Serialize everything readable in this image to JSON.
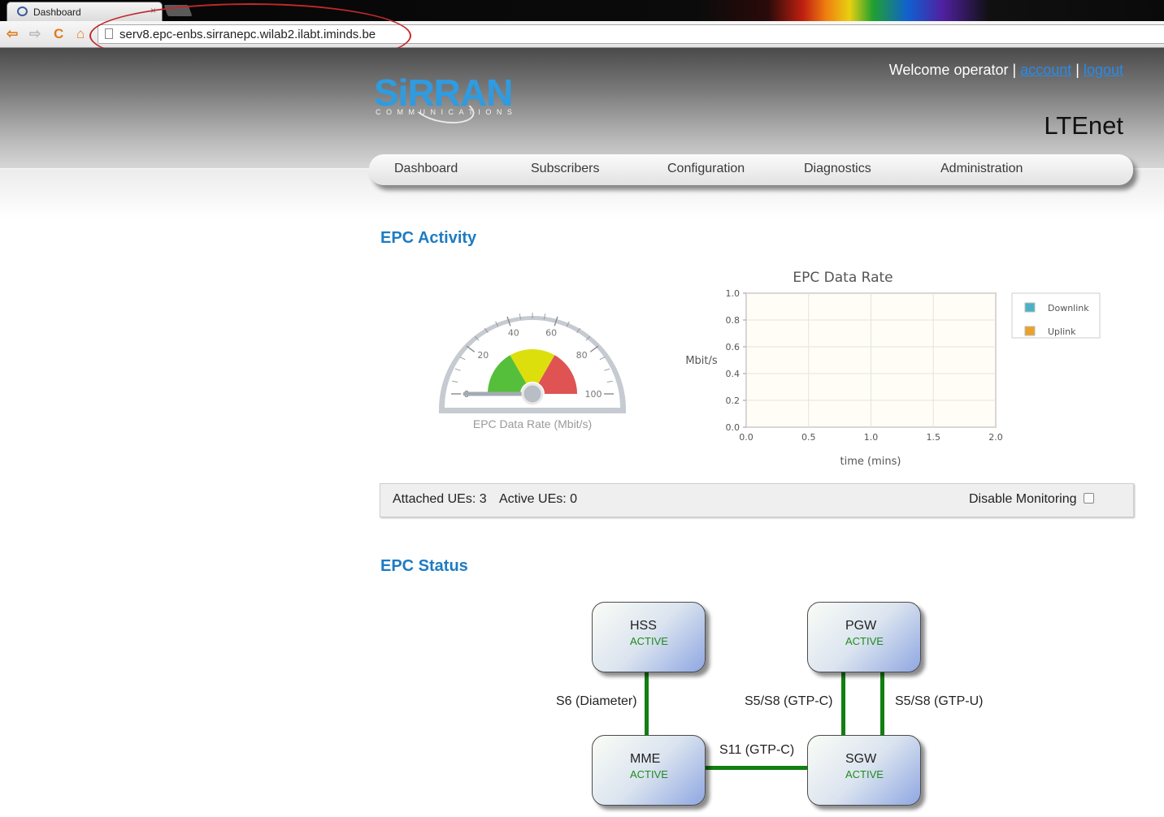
{
  "browser": {
    "tab_title": "Dashboard",
    "tab_close": "×",
    "url": "serv8.epc-enbs.sirranepc.wilab2.ilabt.iminds.be",
    "nav_back": "⇦",
    "nav_forward": "⇨",
    "nav_reload": "C",
    "nav_home": "⌂"
  },
  "header": {
    "logo_text": "SiRRAN",
    "logo_sub": "COMMUNICATIONS",
    "welcome_prefix": "Welcome operator |",
    "account_link": "account",
    "separator": "|",
    "logout_link": "logout",
    "brand": "LTEnet"
  },
  "menu": {
    "items": [
      "Dashboard",
      "Subscribers",
      "Configuration",
      "Diagnostics",
      "Administration"
    ]
  },
  "sections": {
    "activity_title": "EPC Activity",
    "status_title": "EPC Status"
  },
  "gauge": {
    "caption": "EPC Data Rate (Mbit/s)",
    "min": 0,
    "max": 100,
    "value": 0,
    "ticks": [
      "0",
      "20",
      "40",
      "60",
      "80",
      "100"
    ],
    "colors": {
      "green": "#55bf3b",
      "yellow": "#dddf0d",
      "red": "#df5353"
    }
  },
  "chart_data": {
    "type": "line",
    "title": "EPC Data Rate",
    "xlabel": "time (mins)",
    "ylabel": "Mbit/s",
    "xlim": [
      0.0,
      2.0
    ],
    "ylim": [
      0.0,
      1.0
    ],
    "xticks": [
      "0.0",
      "0.5",
      "1.0",
      "1.5",
      "2.0"
    ],
    "yticks": [
      "0.0",
      "0.2",
      "0.4",
      "0.6",
      "0.8",
      "1.0"
    ],
    "grid": true,
    "legend_position": "right",
    "series": [
      {
        "name": "Downlink",
        "color": "#4bb2c5",
        "points": []
      },
      {
        "name": "Uplink",
        "color": "#eaa228",
        "points": []
      }
    ]
  },
  "stats": {
    "attached_label": "Attached UEs: 3",
    "active_label": "Active UEs: 0",
    "disable_monitoring": "Disable Monitoring"
  },
  "network": {
    "nodes": [
      {
        "name": "HSS",
        "status": "ACTIVE"
      },
      {
        "name": "PGW",
        "status": "ACTIVE"
      },
      {
        "name": "MME",
        "status": "ACTIVE"
      },
      {
        "name": "SGW",
        "status": "ACTIVE"
      }
    ],
    "links": [
      {
        "label": "S6 (Diameter)"
      },
      {
        "label": "S5/S8 (GTP-C)"
      },
      {
        "label": "S5/S8 (GTP-U)"
      },
      {
        "label": "S11 (GTP-C)"
      }
    ]
  }
}
